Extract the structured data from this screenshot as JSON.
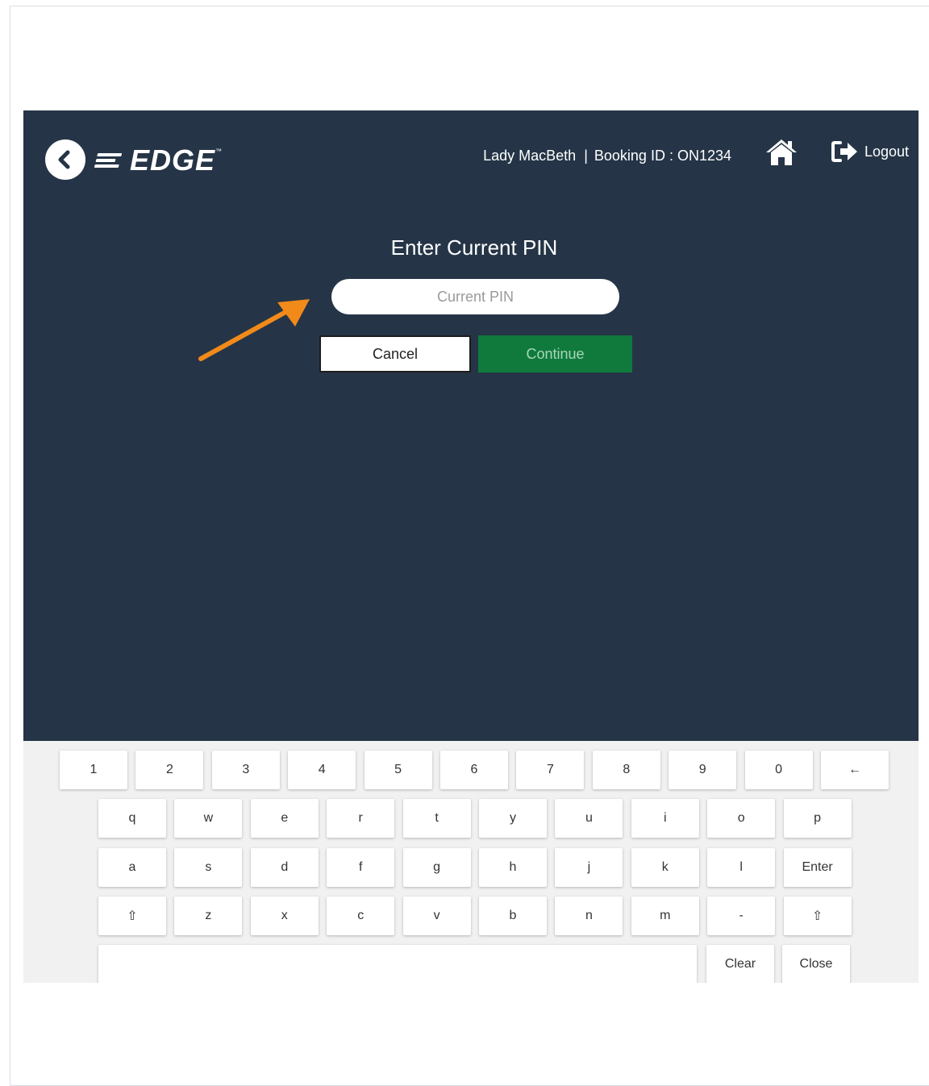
{
  "header": {
    "user_name": "Lady MacBeth",
    "separator": "|",
    "booking": "Booking ID : ON1234",
    "logo_text": "EDGE",
    "logo_tm": "™",
    "logout_label": "Logout"
  },
  "pin": {
    "title": "Enter Current PIN",
    "placeholder": "Current PIN",
    "cancel_label": "Cancel",
    "continue_label": "Continue"
  },
  "keyboard": {
    "row1": [
      "1",
      "2",
      "3",
      "4",
      "5",
      "6",
      "7",
      "8",
      "9",
      "0",
      "←"
    ],
    "row2": [
      "q",
      "w",
      "e",
      "r",
      "t",
      "y",
      "u",
      "i",
      "o",
      "p"
    ],
    "row3": [
      "a",
      "s",
      "d",
      "f",
      "g",
      "h",
      "j",
      "k",
      "l",
      "Enter"
    ],
    "row4": [
      "⇧",
      "z",
      "x",
      "c",
      "v",
      "b",
      "n",
      "m",
      "-",
      "⇧"
    ],
    "clear_label": "Clear",
    "close_label": "Close"
  },
  "colors": {
    "app_bg": "#253547",
    "continue_bg": "#0f7a3c",
    "arrow": "#f28a1a",
    "keyboard_bg": "#f1f1f1"
  }
}
